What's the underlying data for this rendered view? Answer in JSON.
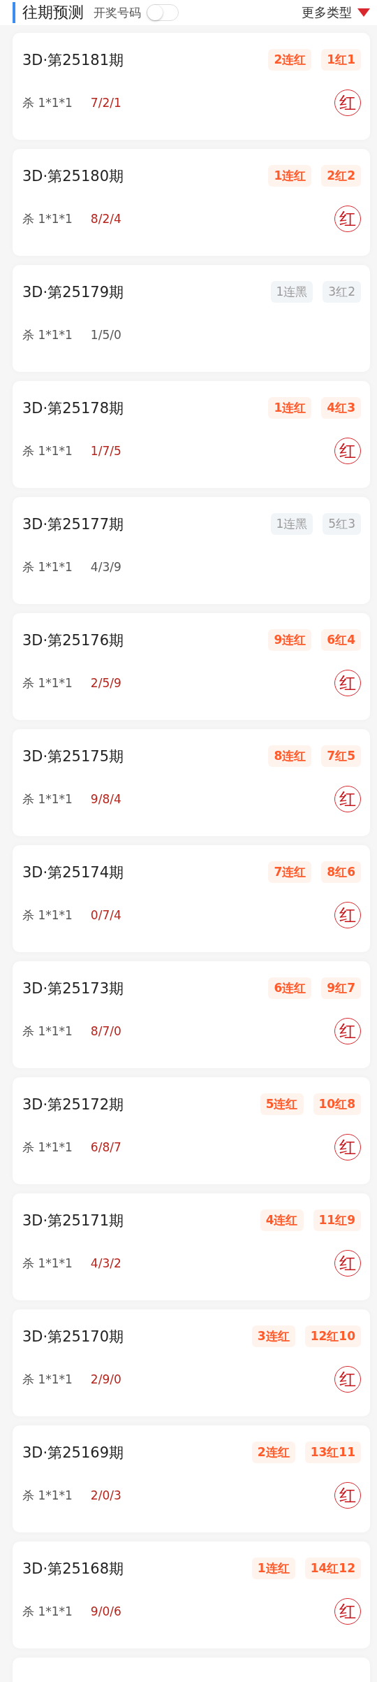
{
  "header": {
    "title": "往期预测",
    "toggle": {
      "label": "开奖号码",
      "on": false
    },
    "more": "更多类型"
  },
  "cards": [
    {
      "issue": "3D·第25181期",
      "hit": true,
      "streak": "2连红",
      "record": "1红1",
      "kill": "杀 1*1*1",
      "numbers": "7/2/1",
      "result": "红"
    },
    {
      "issue": "3D·第25180期",
      "hit": true,
      "streak": "1连红",
      "record": "2红2",
      "kill": "杀 1*1*1",
      "numbers": "8/2/4",
      "result": "红"
    },
    {
      "issue": "3D·第25179期",
      "hit": false,
      "streak": "1连黑",
      "record": "3红2",
      "kill": "杀 1*1*1",
      "numbers": "1/5/0"
    },
    {
      "issue": "3D·第25178期",
      "hit": true,
      "streak": "1连红",
      "record": "4红3",
      "kill": "杀 1*1*1",
      "numbers": "1/7/5",
      "result": "红"
    },
    {
      "issue": "3D·第25177期",
      "hit": false,
      "streak": "1连黑",
      "record": "5红3",
      "kill": "杀 1*1*1",
      "numbers": "4/3/9"
    },
    {
      "issue": "3D·第25176期",
      "hit": true,
      "streak": "9连红",
      "record": "6红4",
      "kill": "杀 1*1*1",
      "numbers": "2/5/9",
      "result": "红"
    },
    {
      "issue": "3D·第25175期",
      "hit": true,
      "streak": "8连红",
      "record": "7红5",
      "kill": "杀 1*1*1",
      "numbers": "9/8/4",
      "result": "红"
    },
    {
      "issue": "3D·第25174期",
      "hit": true,
      "streak": "7连红",
      "record": "8红6",
      "kill": "杀 1*1*1",
      "numbers": "0/7/4",
      "result": "红"
    },
    {
      "issue": "3D·第25173期",
      "hit": true,
      "streak": "6连红",
      "record": "9红7",
      "kill": "杀 1*1*1",
      "numbers": "8/7/0",
      "result": "红"
    },
    {
      "issue": "3D·第25172期",
      "hit": true,
      "streak": "5连红",
      "record": "10红8",
      "kill": "杀 1*1*1",
      "numbers": "6/8/7",
      "result": "红"
    },
    {
      "issue": "3D·第25171期",
      "hit": true,
      "streak": "4连红",
      "record": "11红9",
      "kill": "杀 1*1*1",
      "numbers": "4/3/2",
      "result": "红"
    },
    {
      "issue": "3D·第25170期",
      "hit": true,
      "streak": "3连红",
      "record": "12红10",
      "kill": "杀 1*1*1",
      "numbers": "2/9/0",
      "result": "红"
    },
    {
      "issue": "3D·第25169期",
      "hit": true,
      "streak": "2连红",
      "record": "13红11",
      "kill": "杀 1*1*1",
      "numbers": "2/0/3",
      "result": "红"
    },
    {
      "issue": "3D·第25168期",
      "hit": true,
      "streak": "1连红",
      "record": "14红12",
      "kill": "杀 1*1*1",
      "numbers": "9/0/6",
      "result": "红"
    }
  ]
}
